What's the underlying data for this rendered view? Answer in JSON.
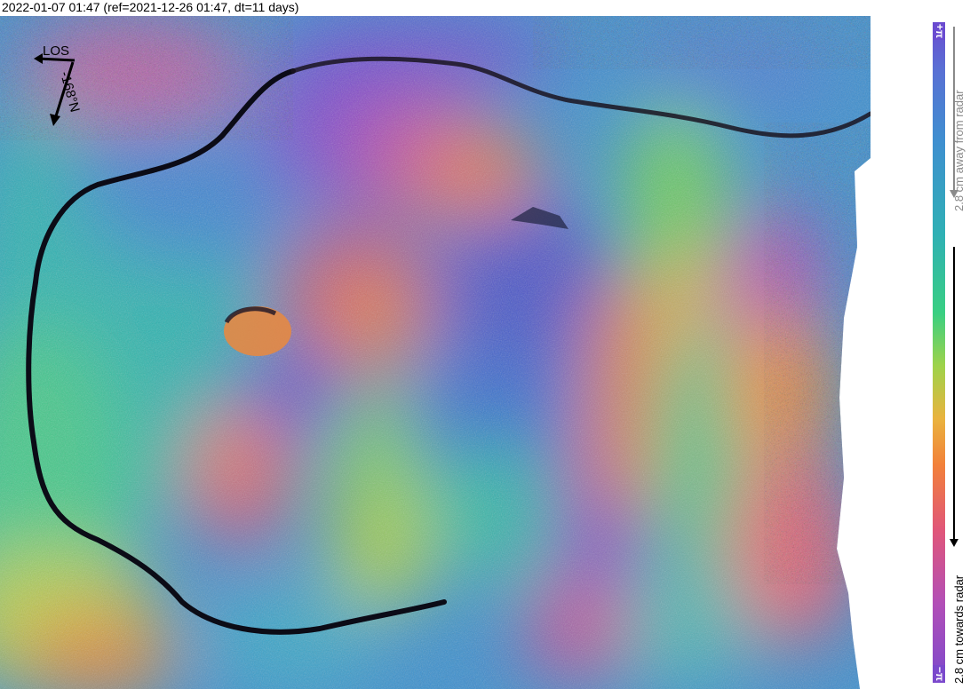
{
  "header": {
    "title": "2022-01-07 01:47 (ref=2021-12-26 01:47, dt=11 days)"
  },
  "compass": {
    "los_label": "LOS",
    "north_label": "-168°N"
  },
  "colorbar": {
    "top_label": "+π",
    "bottom_label": "−π",
    "away_label": "2.8 cm away from radar",
    "towards_label": "2.8 cm towards radar",
    "palette": [
      "#6a4bd0",
      "#3f8fd0",
      "#2fb0b5",
      "#39cf82",
      "#9ed34a",
      "#e9b33e",
      "#f2813a",
      "#e0567a",
      "#b24fb7",
      "#7b49cc"
    ]
  }
}
